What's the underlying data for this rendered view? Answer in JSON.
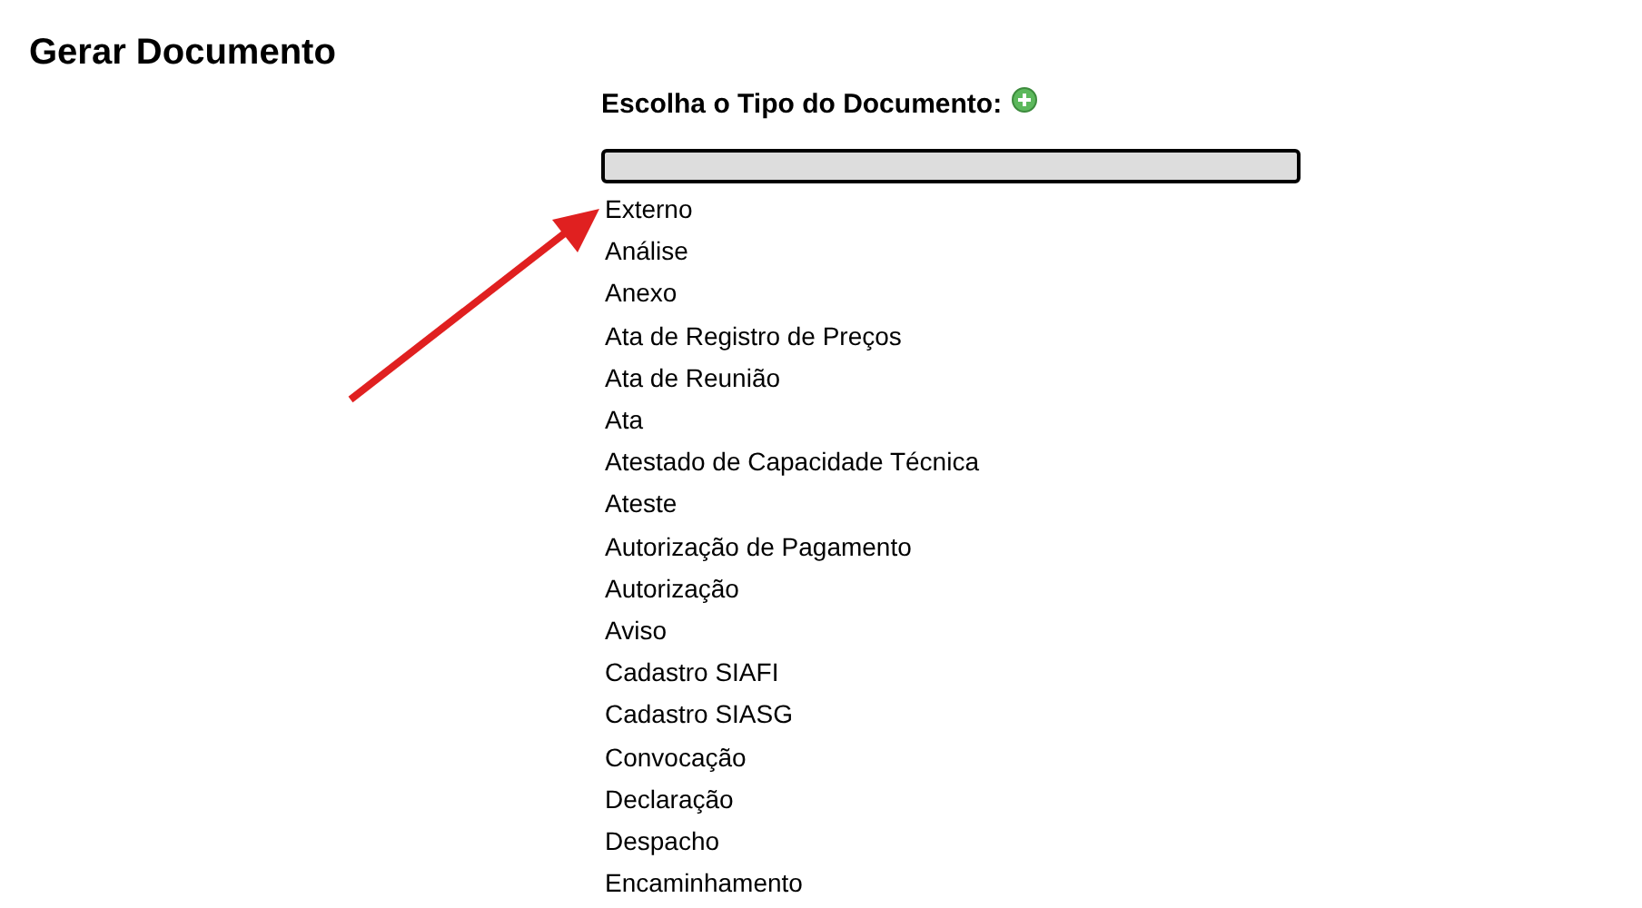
{
  "page_title": "Gerar Documento",
  "chooser": {
    "label": "Escolha o Tipo do Documento:",
    "options": [
      "Externo",
      "Análise",
      "Anexo",
      "Ata de Registro de Preços",
      "Ata de Reunião",
      "Ata",
      "Atestado de Capacidade Técnica",
      "Ateste",
      "Autorização de Pagamento",
      "Autorização",
      "Aviso",
      "Cadastro SIAFI",
      "Cadastro SIASG",
      "Convocação",
      "Declaração",
      "Despacho",
      "Encaminhamento"
    ]
  }
}
